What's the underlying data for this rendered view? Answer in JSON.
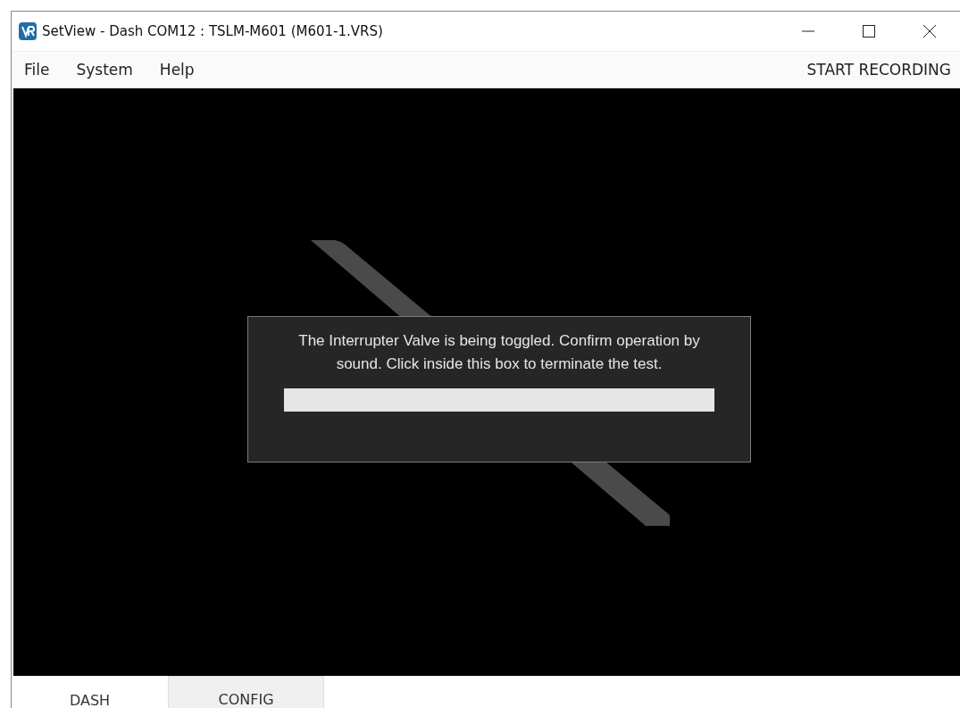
{
  "window": {
    "title": "SetView - Dash COM12 : TSLM-M601 (M601-1.VRS)"
  },
  "menu": [
    "File",
    "System",
    "Help"
  ],
  "menu_right": "START RECORDING",
  "dialog": {
    "message": "The Interrupter Valve is being toggled. Confirm operation by sound. Click inside this box to terminate the test.",
    "level": 1
  },
  "tabs": [
    {
      "label": "DASH",
      "selected": true
    },
    {
      "label": "CONFIG",
      "selected": false
    }
  ]
}
